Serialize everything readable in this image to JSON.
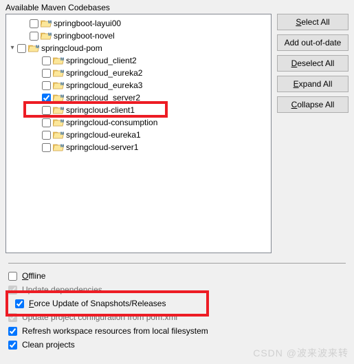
{
  "panel": {
    "title": "Available Maven Codebases"
  },
  "buttons": {
    "select_all": "Select All",
    "add_out_of_date": "Add out-of-date",
    "deselect_all": "Deselect All",
    "expand_all": "Expand All",
    "collapse_all": "Collapse All"
  },
  "tree": [
    {
      "indent": 1,
      "twisty": "none",
      "checked": false,
      "label": "springboot-layui00"
    },
    {
      "indent": 1,
      "twisty": "none",
      "checked": false,
      "label": "springboot-novel"
    },
    {
      "indent": 0,
      "twisty": "open",
      "checked": false,
      "label": "springcloud-pom"
    },
    {
      "indent": 2,
      "twisty": "none",
      "checked": false,
      "label": "springcloud_client2"
    },
    {
      "indent": 2,
      "twisty": "none",
      "checked": false,
      "label": "springcloud_eureka2"
    },
    {
      "indent": 2,
      "twisty": "none",
      "checked": false,
      "label": "springcloud_eureka3"
    },
    {
      "indent": 2,
      "twisty": "none",
      "checked": true,
      "label": "springcloud_server2"
    },
    {
      "indent": 2,
      "twisty": "none",
      "checked": false,
      "label": "springcloud-client1"
    },
    {
      "indent": 2,
      "twisty": "none",
      "checked": false,
      "label": "springcloud-consumption"
    },
    {
      "indent": 2,
      "twisty": "none",
      "checked": false,
      "label": "springcloud-eureka1"
    },
    {
      "indent": 2,
      "twisty": "none",
      "checked": false,
      "label": "springcloud-server1"
    }
  ],
  "options": {
    "offline": {
      "label": "Offline",
      "checked": false,
      "enabled": true
    },
    "update_deps": {
      "label": "Update dependencies",
      "checked": true,
      "enabled": false
    },
    "force_update": {
      "label": "Force Update of Snapshots/Releases",
      "checked": true,
      "enabled": true
    },
    "update_proj": {
      "label": "Update project configuration from pom.xml",
      "checked": true,
      "enabled": false
    },
    "refresh_ws": {
      "label": "Refresh workspace resources from local filesystem",
      "checked": true,
      "enabled": true
    },
    "clean_proj": {
      "label": "Clean projects",
      "checked": true,
      "enabled": true
    }
  },
  "watermark": "CSDN @波来波来转"
}
